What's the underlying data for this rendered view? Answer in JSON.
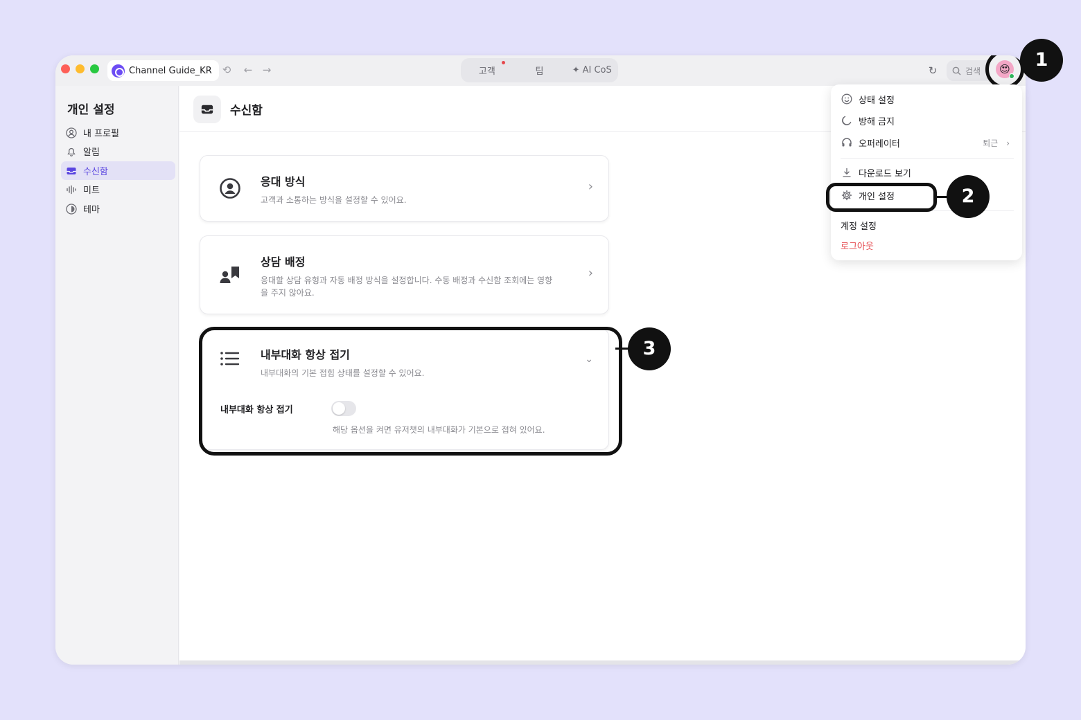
{
  "titlebar": {
    "channel_name": "Channel Guide_KR",
    "tabs": [
      {
        "label": "고객",
        "has_dot": true
      },
      {
        "label": "팀",
        "has_dot": false
      },
      {
        "label": "✦ AI CoS",
        "has_dot": false
      }
    ],
    "search_label": "검색",
    "avatar_icon": "emoji-heart-eyes-icon"
  },
  "sidebar": {
    "title": "개인 설정",
    "items": [
      {
        "label": "내 프로필",
        "icon": "profile-icon",
        "active": false
      },
      {
        "label": "알림",
        "icon": "bell-icon",
        "active": false
      },
      {
        "label": "수신함",
        "icon": "inbox-icon",
        "active": true
      },
      {
        "label": "미트",
        "icon": "waveform-icon",
        "active": false
      },
      {
        "label": "테마",
        "icon": "theme-icon",
        "active": false
      }
    ]
  },
  "main": {
    "title": "수신함",
    "cards": [
      {
        "title": "응대 방식",
        "desc": "고객과 소통하는 방식을 설정할 수 있어요."
      },
      {
        "title": "상담 배정",
        "desc": "응대할 상담 유형과 자동 배정 방식을 설정합니다. 수동 배정과 수신함 조회에는 영향을 주지 않아요."
      },
      {
        "title": "내부대화 항상 접기",
        "desc": "내부대화의 기본 접힘 상태를 설정할 수 있어요.",
        "toggle": {
          "label": "내부대화 항상 접기",
          "on": false,
          "help": "해당 옵션을 켜면 유저챗의 내부대화가 기본으로 접혀 있어요."
        }
      }
    ]
  },
  "menu": {
    "items": [
      {
        "label": "상태 설정",
        "icon": "smiley-icon"
      },
      {
        "label": "방해 금지",
        "icon": "moon-icon"
      },
      {
        "label": "오퍼레이터",
        "icon": "headset-icon",
        "value": "퇴근"
      },
      {
        "label": "다운로드 보기",
        "icon": "download-icon"
      },
      {
        "label": "개인 설정",
        "icon": "gear-icon"
      },
      {
        "label": "계정 설정"
      },
      {
        "label": "로그아웃",
        "color": "#e5484d"
      }
    ]
  },
  "annotations": {
    "badges": [
      "1",
      "2",
      "3"
    ]
  },
  "colors": {
    "background": "#e3e1fb",
    "accent": "#5a45e0",
    "danger": "#e5484d"
  }
}
